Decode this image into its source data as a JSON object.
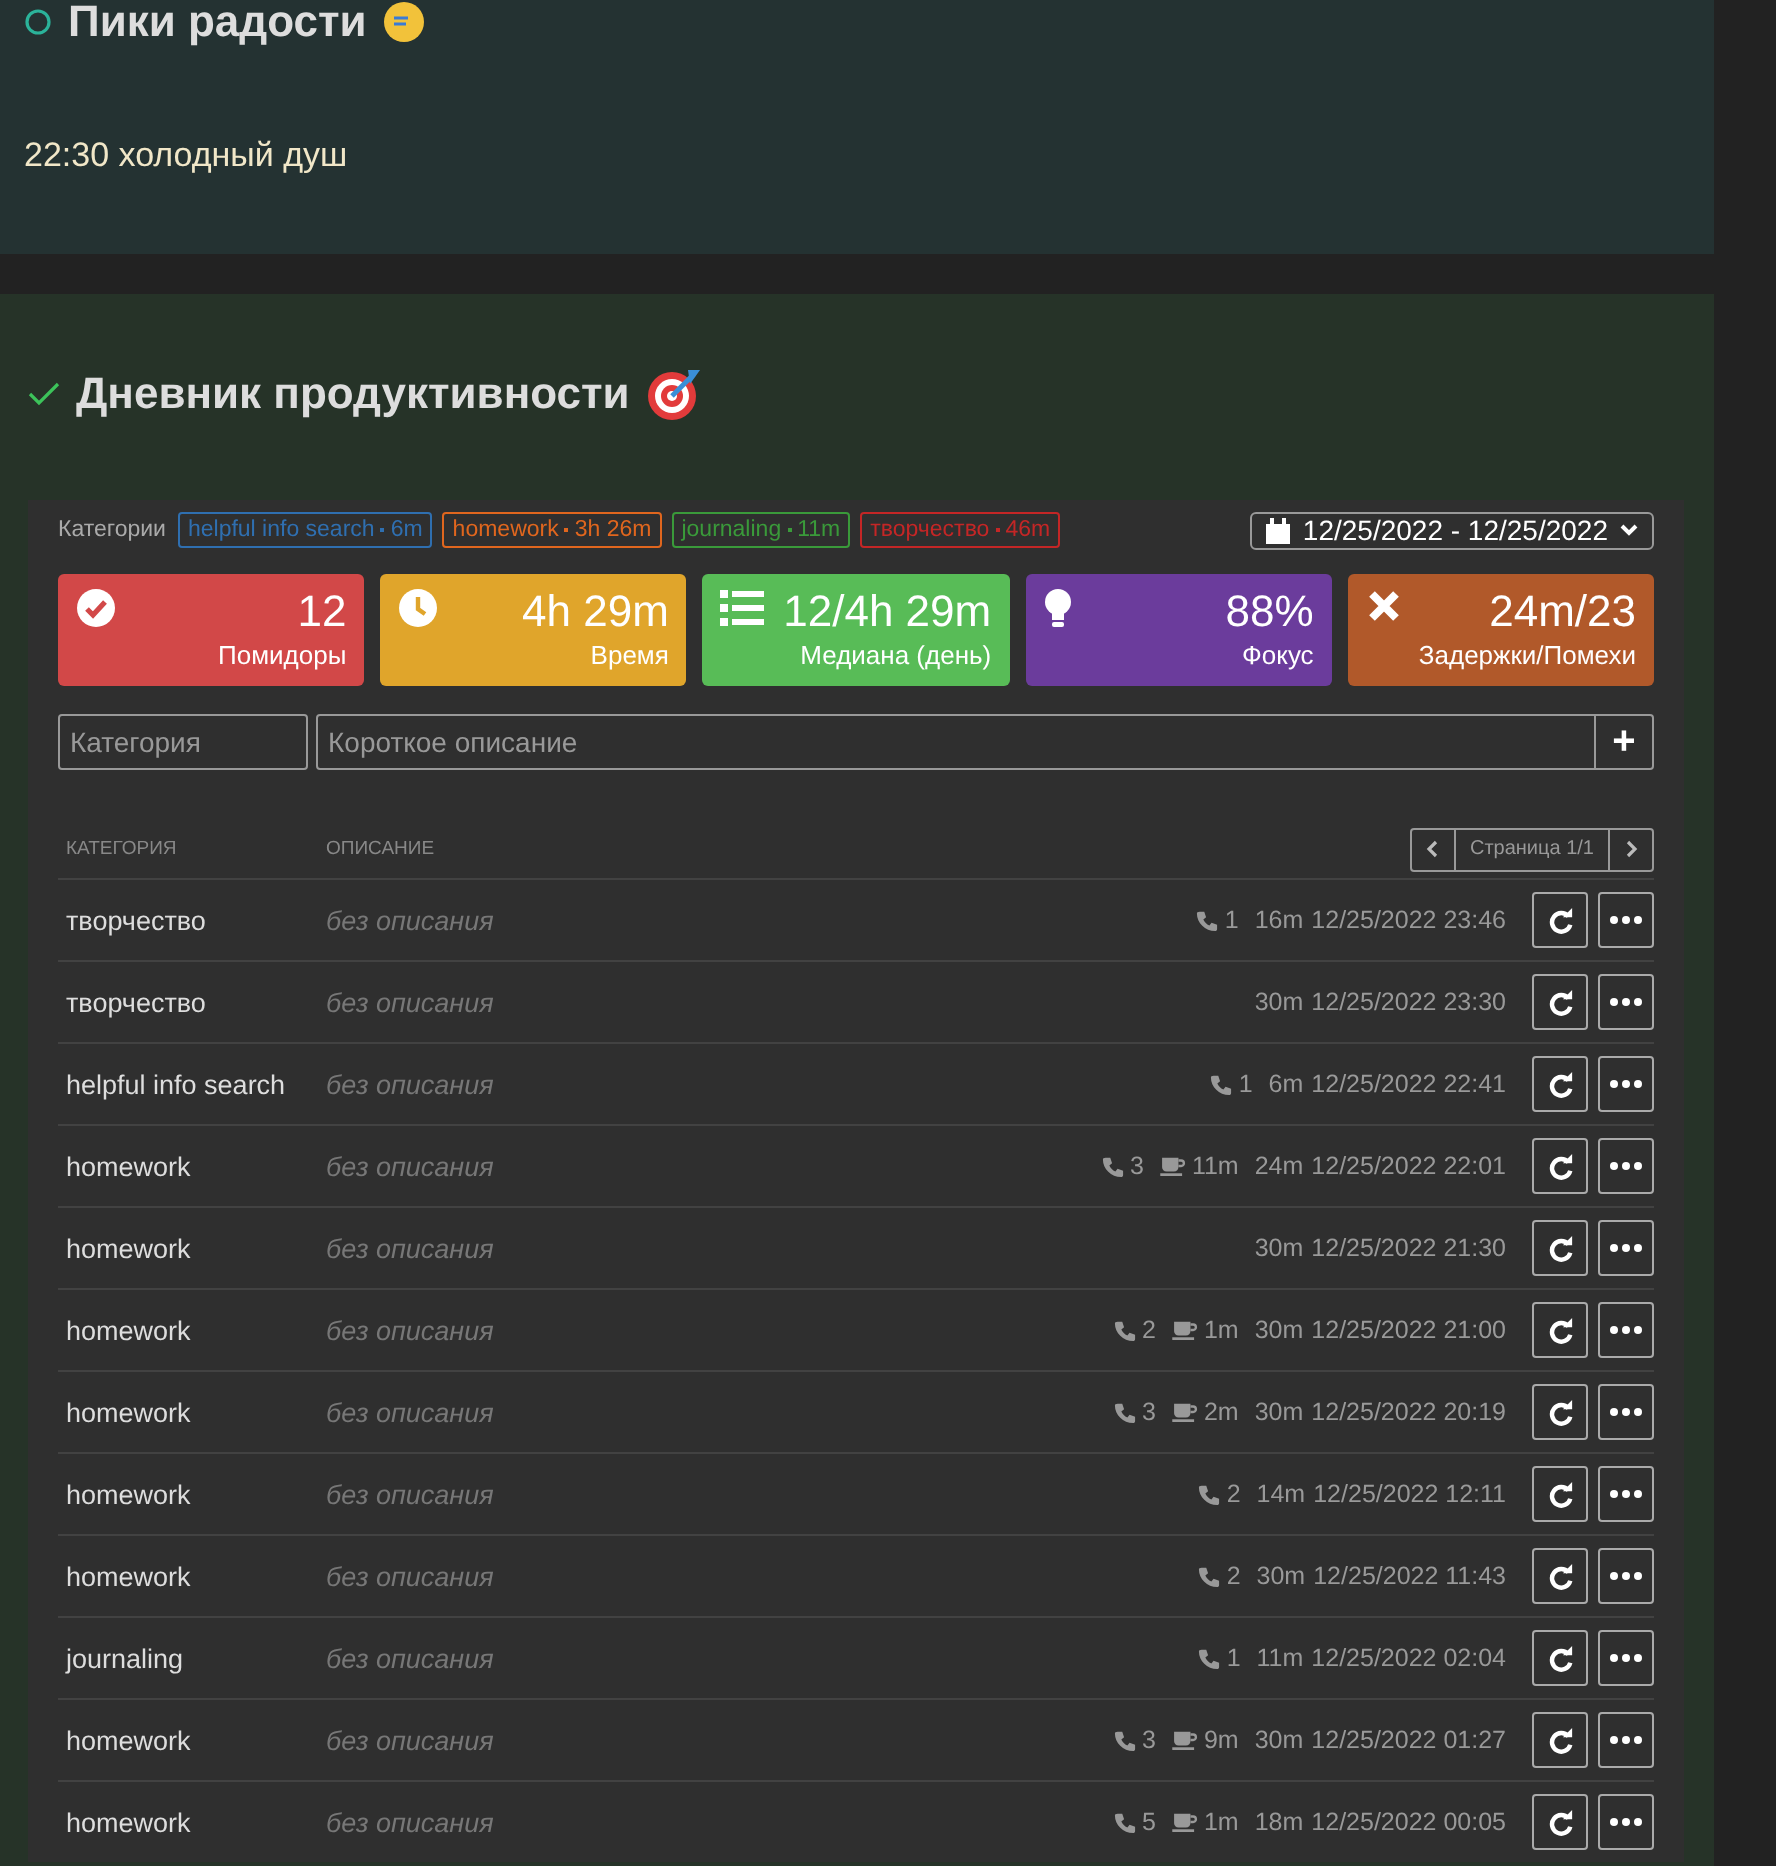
{
  "joy_section": {
    "title": "Пики радости",
    "note": "22:30 холодный душ"
  },
  "productivity": {
    "title": "Дневник продуктивности",
    "categories_label": "Категории",
    "categories": [
      {
        "name": "helpful info search",
        "total": "6m",
        "color": "#2f6fb0"
      },
      {
        "name": "homework",
        "total": "3h 26m",
        "color": "#e0661e"
      },
      {
        "name": "journaling",
        "total": "11m",
        "color": "#3a9a3a"
      },
      {
        "name": "творчество",
        "total": "46m",
        "color": "#c42626"
      }
    ],
    "date_range": "12/25/2022 - 12/25/2022",
    "stats": [
      {
        "kind": "check",
        "value": "12",
        "label": "Помидоры",
        "color": "#d24848"
      },
      {
        "kind": "clock",
        "value": "4h 29m",
        "label": "Время",
        "color": "#e0a52b"
      },
      {
        "kind": "list",
        "value": "12/4h 29m",
        "label": "Медиана (день)",
        "color": "#58bc57"
      },
      {
        "kind": "bulb",
        "value": "88%",
        "label": "Фокус",
        "color": "#6b3c9c"
      },
      {
        "kind": "cross",
        "value": "24m/23",
        "label": "Задержки/Помехи",
        "color": "#b1592a"
      }
    ],
    "category_field": {
      "placeholder": "Категория"
    },
    "description_field": {
      "placeholder": "Короткое описание"
    },
    "add_button": "+",
    "columns": [
      "КАТЕГОРИЯ",
      "ОПИСАНИЕ"
    ],
    "pager": "Страница 1/1",
    "rows": [
      {
        "category": "творчество",
        "description": "без описания",
        "calls": "1",
        "duration": "16m",
        "datetime": "12/25/2022 23:46"
      },
      {
        "category": "творчество",
        "description": "без описания",
        "duration": "30m",
        "datetime": "12/25/2022 23:30"
      },
      {
        "category": "helpful info search",
        "description": "без описания",
        "calls": "1",
        "duration": "6m",
        "datetime": "12/25/2022 22:41"
      },
      {
        "category": "homework",
        "description": "без описания",
        "calls": "3",
        "break": "11m",
        "duration": "24m",
        "datetime": "12/25/2022 22:01"
      },
      {
        "category": "homework",
        "description": "без описания",
        "duration": "30m",
        "datetime": "12/25/2022 21:30"
      },
      {
        "category": "homework",
        "description": "без описания",
        "calls": "2",
        "break": "1m",
        "duration": "30m",
        "datetime": "12/25/2022 21:00"
      },
      {
        "category": "homework",
        "description": "без описания",
        "calls": "3",
        "break": "2m",
        "duration": "30m",
        "datetime": "12/25/2022 20:19"
      },
      {
        "category": "homework",
        "description": "без описания",
        "calls": "2",
        "duration": "14m",
        "datetime": "12/25/2022 12:11"
      },
      {
        "category": "homework",
        "description": "без описания",
        "calls": "2",
        "duration": "30m",
        "datetime": "12/25/2022 11:43"
      },
      {
        "category": "journaling",
        "description": "без описания",
        "calls": "1",
        "duration": "11m",
        "datetime": "12/25/2022 02:04"
      },
      {
        "category": "homework",
        "description": "без описания",
        "calls": "3",
        "break": "9m",
        "duration": "30m",
        "datetime": "12/25/2022 01:27"
      },
      {
        "category": "homework",
        "description": "без описания",
        "calls": "5",
        "break": "1m",
        "duration": "18m",
        "datetime": "12/25/2022 00:05"
      }
    ]
  }
}
